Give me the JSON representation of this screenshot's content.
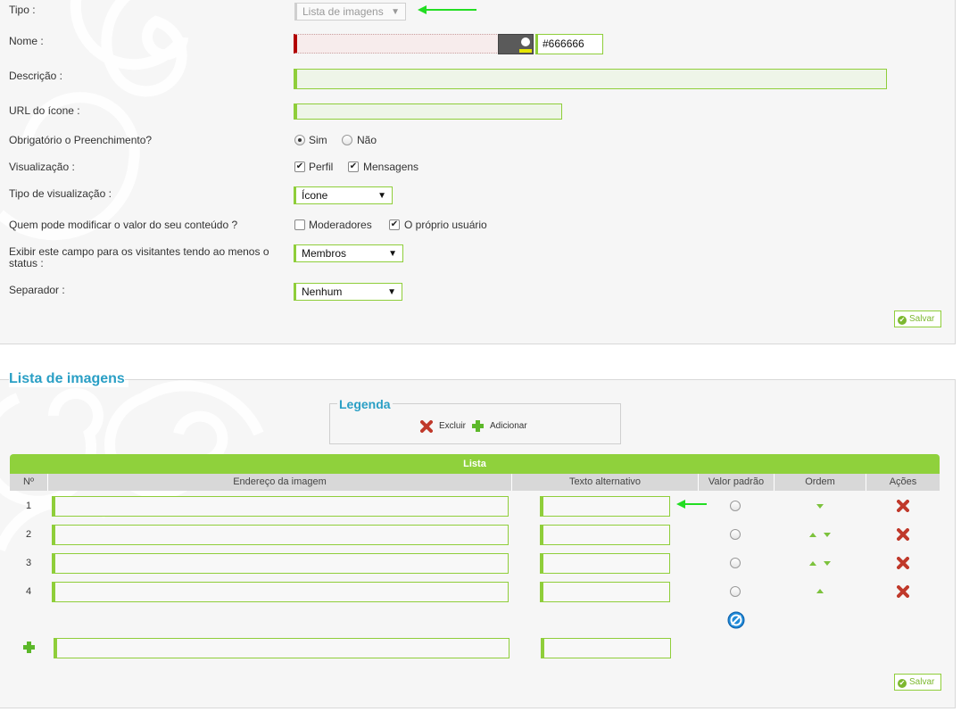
{
  "form": {
    "tipo": {
      "label": "Tipo :",
      "value": "Lista de imagens"
    },
    "nome": {
      "label": "Nome :",
      "value": "",
      "color_value": "#666666"
    },
    "descricao": {
      "label": "Descrição :",
      "value": ""
    },
    "url_icone": {
      "label": "URL do ícone :",
      "value": ""
    },
    "obrigatorio": {
      "label": "Obrigatório o Preenchimento?",
      "options": [
        "Sim",
        "Não"
      ],
      "selected": "Sim"
    },
    "visualizacao": {
      "label": "Visualização :",
      "options": [
        {
          "label": "Perfil",
          "checked": true
        },
        {
          "label": "Mensagens",
          "checked": true
        }
      ]
    },
    "tipo_visualizacao": {
      "label": "Tipo de visualização :",
      "value": "Ícone"
    },
    "quem_modifica": {
      "label": "Quem pode modificar o valor do seu conteúdo ?",
      "options": [
        {
          "label": "Moderadores",
          "checked": false
        },
        {
          "label": "O próprio usuário",
          "checked": true
        }
      ]
    },
    "exibir_campo": {
      "label": "Exibir este campo para os visitantes tendo ao menos o status :",
      "value": "Membros"
    },
    "separador": {
      "label": "Separador :",
      "value": "Nenhum"
    },
    "save_label": "Salvar"
  },
  "lista": {
    "section_title": "Lista de imagens",
    "legend": {
      "title": "Legenda",
      "delete_label": "Excluir",
      "add_label": "Adicionar"
    },
    "table_title": "Lista",
    "columns": [
      "Nº",
      "Endereço da imagem",
      "Texto alternativo",
      "Valor padrão",
      "Ordem",
      "Ações"
    ],
    "rows": [
      {
        "num": "1",
        "address": "",
        "alt": "",
        "order": [
          "down"
        ]
      },
      {
        "num": "2",
        "address": "",
        "alt": "",
        "order": [
          "up",
          "down"
        ]
      },
      {
        "num": "3",
        "address": "",
        "alt": "",
        "order": [
          "up",
          "down"
        ]
      },
      {
        "num": "4",
        "address": "",
        "alt": "",
        "order": [
          "up"
        ]
      }
    ],
    "save_label": "Salvar"
  },
  "colors": {
    "accent_green": "#8fd13c",
    "title_blue": "#2a9fc5",
    "delete_red": "#c0392b",
    "arrow_green": "#22dd22"
  }
}
